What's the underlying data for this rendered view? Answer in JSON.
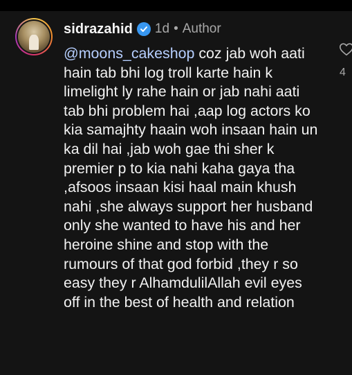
{
  "comment": {
    "username": "sidrazahid",
    "time": "1d",
    "separator": "•",
    "role": "Author",
    "mention": "@moons_cakeshop",
    "text": " coz jab woh aati hain tab bhi log troll karte hain k limelight ly rahe hain or jab nahi aati tab bhi problem hai ,aap log actors ko kia samajhty haain woh insaan hain un ka dil hai ,jab woh gae thi sher k premier p to kia nahi kaha gaya tha ,afsoos insaan kisi haal main khush nahi ,she always support her husband only she wanted to have his and her heroine shine and stop with the rumours of that god forbid ,they r so easy they r AlhamdulilAllah evil eyes off in the best of health and relation",
    "like_count": "4"
  },
  "colors": {
    "background": "#141414",
    "mention": "#b6cfff",
    "verified": "#3897f0",
    "meta": "#a8a8a8"
  },
  "icons": {
    "verified": "verified-badge-icon",
    "like": "heart-outline-icon"
  }
}
